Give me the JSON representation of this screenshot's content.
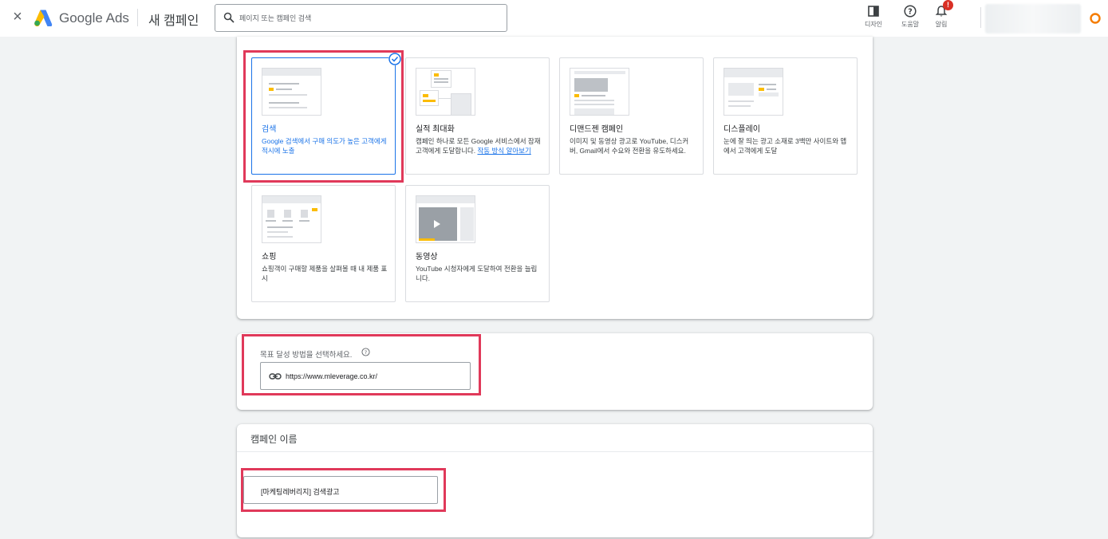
{
  "topbar": {
    "close_label": "×",
    "brand": "Google Ads",
    "title": "새 캠페인",
    "search_placeholder": "페이지 또는 캠페인 검색",
    "tools": [
      {
        "label": "디자인",
        "icon": "appearance-icon"
      },
      {
        "label": "도움말",
        "icon": "help-icon"
      },
      {
        "label": "알림",
        "icon": "bell-icon",
        "badge": "!"
      }
    ]
  },
  "campaign_types": [
    {
      "title": "검색",
      "description": "Google 검색에서 구매 의도가 높은 고객에게 적시에 노출",
      "selected": true
    },
    {
      "title": "실적 최대화",
      "description": "캠페인 하나로 모든 Google 서비스에서 잠재고객에게 도달합니다.",
      "link": "작동 방식 알아보기",
      "selected": false
    },
    {
      "title": "디맨드젠 캠페인",
      "description": "이미지 및 동영상 광고로 YouTube, 디스커버, Gmail에서 수요와 전환을 유도하세요.",
      "selected": false
    },
    {
      "title": "디스플레이",
      "description": "눈에 잘 띄는 광고 소재로 3백만 사이트와 앱에서 고객에게 도달",
      "selected": false
    },
    {
      "title": "쇼핑",
      "description": "쇼핑객이 구매할 제품을 살펴볼 때 내 제품 표시",
      "selected": false
    },
    {
      "title": "동영상",
      "description": "YouTube 시청자에게 도달하여 전환을 늘립니다.",
      "selected": false
    }
  ],
  "goal": {
    "label": "목표 달성 방법을 선택하세요.",
    "url": "https://www.mleverage.co.kr/"
  },
  "campaign_name": {
    "header": "캠페인 이름",
    "value": "[마케팅레버리지] 검색광고"
  },
  "colors": {
    "accent": "#1a73e8",
    "highlight": "#e0395a",
    "alert": "#d93025"
  }
}
